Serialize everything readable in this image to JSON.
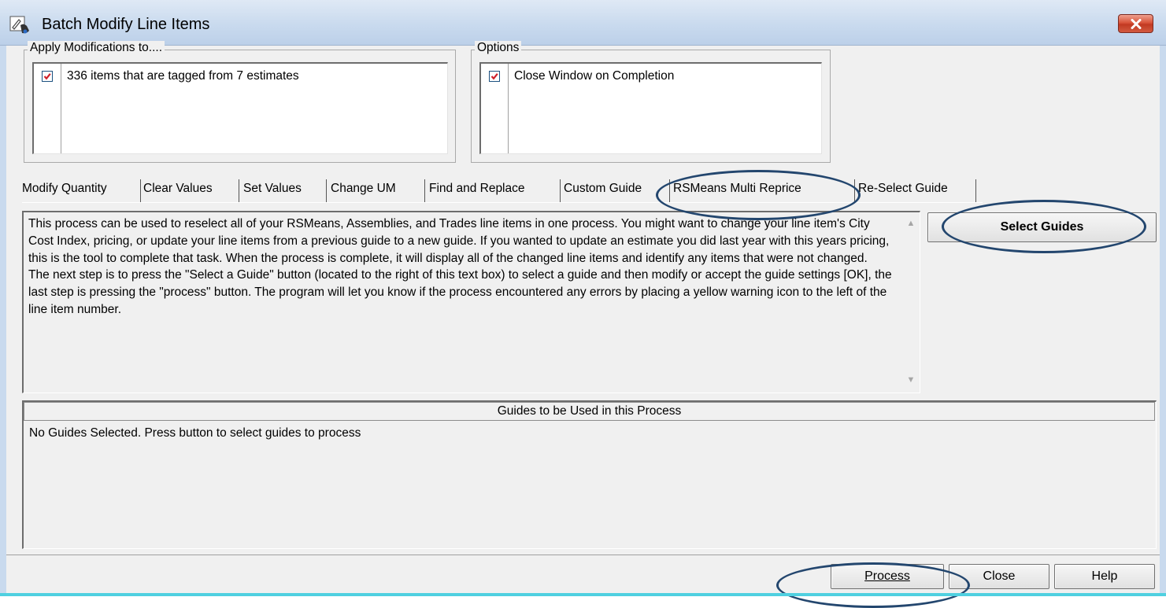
{
  "window": {
    "title": "Batch Modify Line Items",
    "close_icon": "close-icon",
    "app_icon": "hand-pencil-icon"
  },
  "apply_group": {
    "legend": "Apply Modifications to....",
    "items": [
      {
        "label": "336 items that are tagged from 7 estimates",
        "checked": true
      }
    ]
  },
  "options_group": {
    "legend": "Options",
    "items": [
      {
        "label": "Close Window on Completion",
        "checked": true
      }
    ]
  },
  "tabs": [
    {
      "label": "Modify Quantity"
    },
    {
      "label": "Clear Values"
    },
    {
      "label": "Set Values"
    },
    {
      "label": "Change UM"
    },
    {
      "label": "Find and Replace"
    },
    {
      "label": "Custom Guide"
    },
    {
      "label": "RSMeans Multi Reprice",
      "active": true
    },
    {
      "label": "Re-Select Guide"
    }
  ],
  "description": {
    "paragraph1": "This process can be used to reselect all of your RSMeans, Assemblies, and Trades line items in one process.  You might want to change your line item's City Cost Index, pricing, or update your line items from a previous guide to a new guide.  If you wanted to update an estimate you did last year with this years pricing, this is the tool to complete that task.  When the process is complete, it will display all of the changed line items and identify any items that were not changed.",
    "paragraph2": "The next step is to press the \"Select a Guide\" button (located to the right of this text box) to select a guide and then modify or accept the guide settings [OK], the last step is pressing the \"process\" button.  The program will let you know if the process encountered any errors by placing a yellow warning icon to the left of the line item number."
  },
  "select_guides_button": "Select Guides",
  "guides_list": {
    "header": "Guides to be Used in this Process",
    "empty_text": "No Guides Selected. Press button to select guides to process"
  },
  "footer_buttons": {
    "process": "Process",
    "close": "Close",
    "help": "Help"
  },
  "colors": {
    "title_bar": "#c9daee",
    "dialog_bg": "#f0f0f0",
    "close_button": "#d9543a",
    "highlight_ellipse": "#23466e",
    "checkmark": "#d0202a"
  }
}
